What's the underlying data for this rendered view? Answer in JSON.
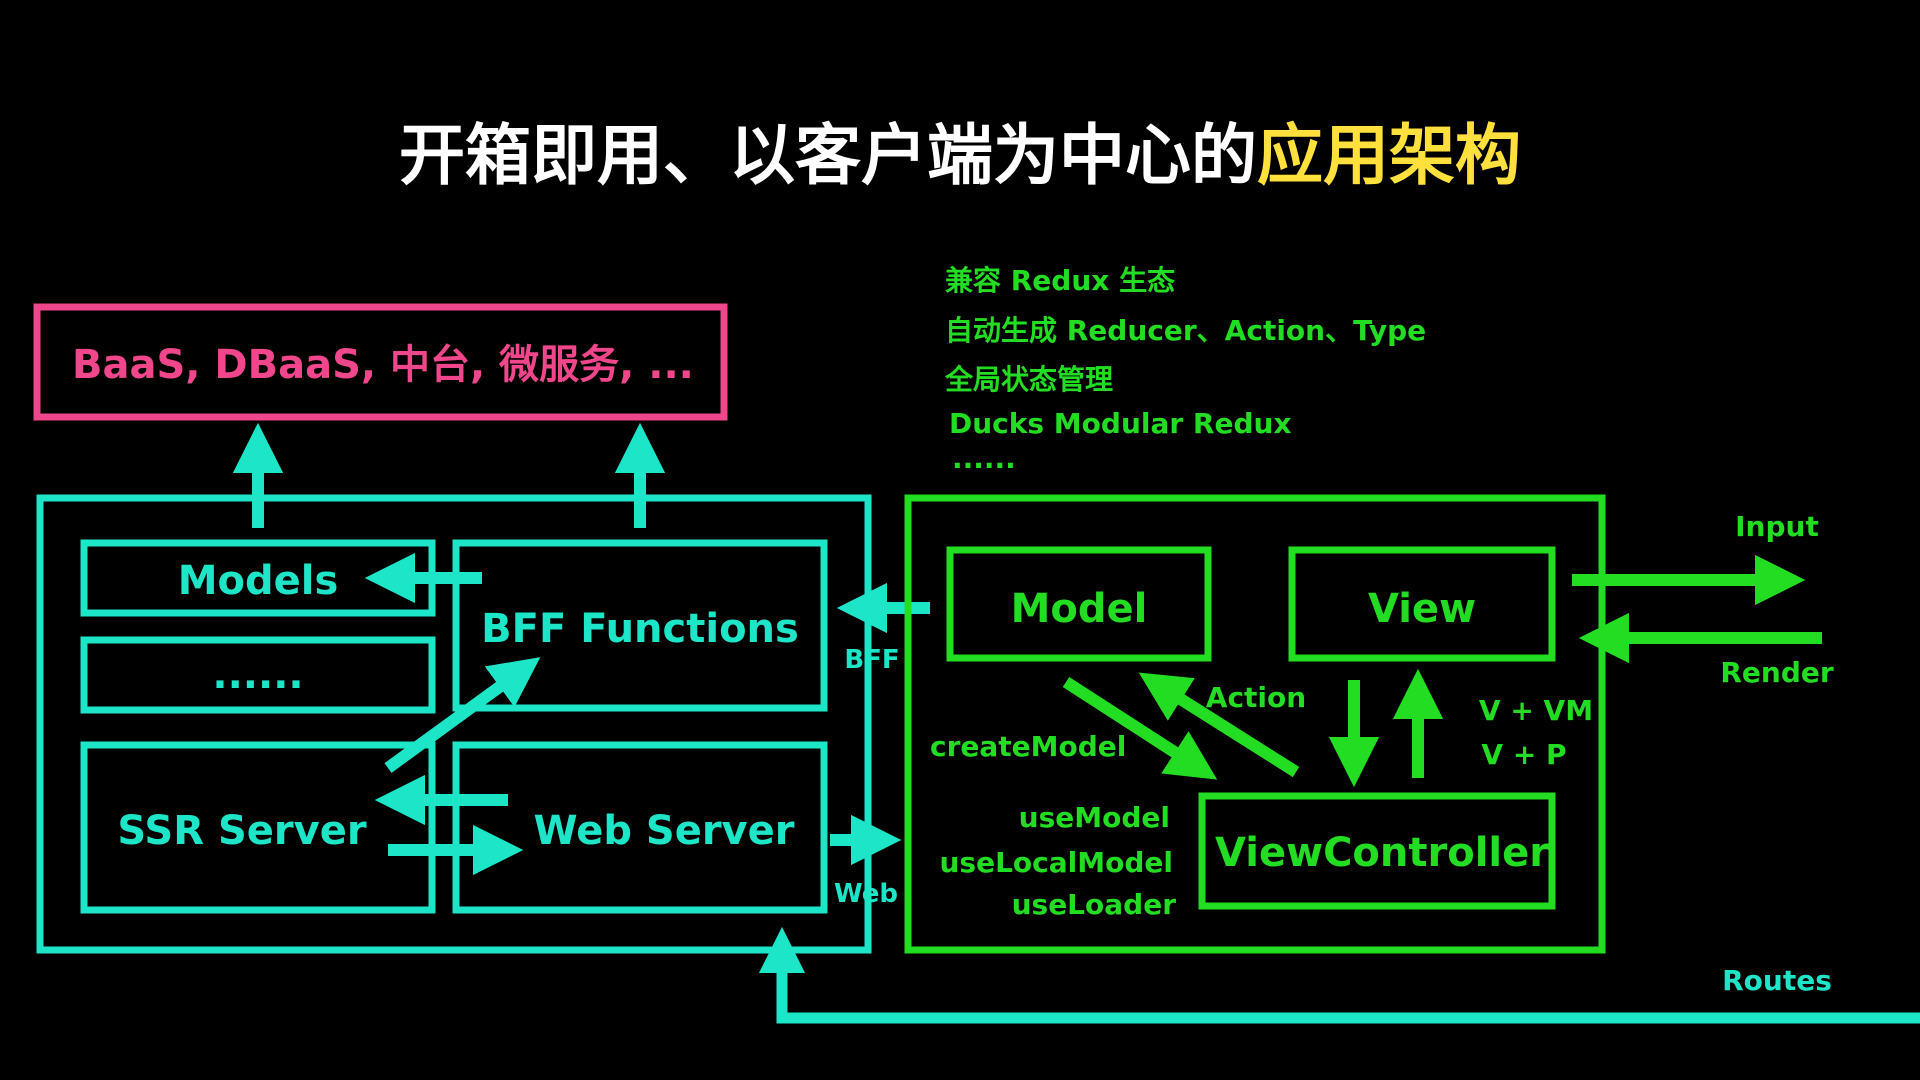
{
  "title": {
    "white": "开箱即用、以客户端为中心的",
    "accent": "应用架构"
  },
  "colors": {
    "background": "#000000",
    "white": "#ffffff",
    "accent": "#ffe03c",
    "pink": "#f0468c",
    "cyan": "#1de5c8",
    "green": "#22dd22"
  },
  "baas_box": "BaaS, DBaaS, 中台, 微服务, ...",
  "server": {
    "models": "Models",
    "dots": "......",
    "bff_functions": "BFF Functions",
    "ssr_server": "SSR Server",
    "web_server": "Web Server"
  },
  "connectors": {
    "bff": "BFF",
    "web": "Web"
  },
  "redux_notes": [
    "兼容 Redux 生态",
    "自动生成 Reducer、Action、Type",
    "全局状态管理",
    "Ducks Modular Redux",
    "......"
  ],
  "client": {
    "model": "Model",
    "view": "View",
    "view_controller": "ViewController",
    "action": "Action",
    "create_model": "createModel",
    "use_model": "useModel",
    "use_local_model": "useLocalModel",
    "use_loader": "useLoader",
    "v_vm": "V + VM",
    "v_p": "V + P"
  },
  "io": {
    "input": "Input",
    "render": "Render",
    "routes": "Routes"
  }
}
